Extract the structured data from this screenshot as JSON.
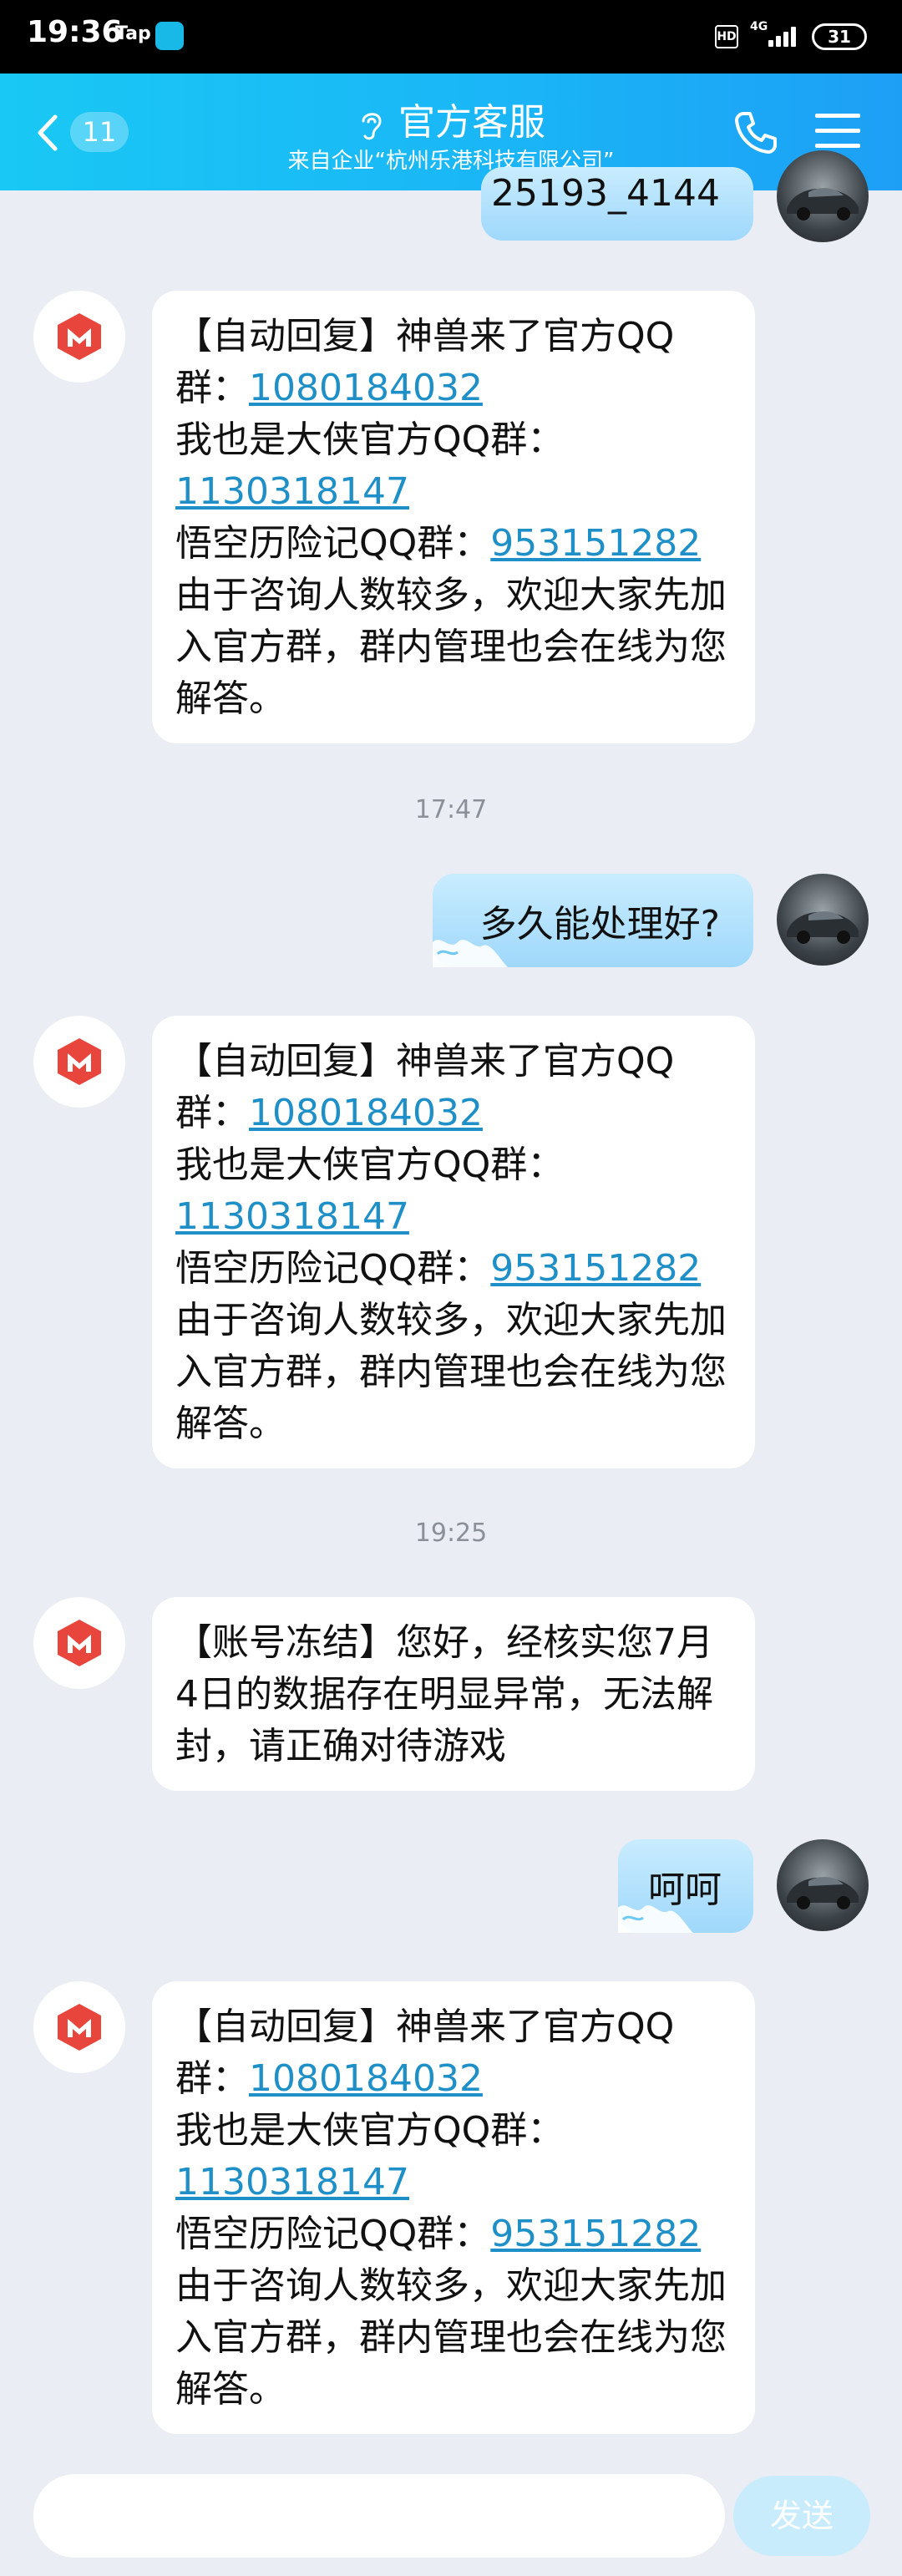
{
  "status_bar": {
    "time": "19:36",
    "tap_label": "Tap",
    "hd_label": "HD",
    "network_label": "4G",
    "battery_level": "31"
  },
  "header": {
    "back_count": "11",
    "title": "官方客服",
    "subtitle": "来自企业“杭州乐港科技有限公司”"
  },
  "messages": {
    "partial_user": "25193_4144",
    "auto_reply": {
      "p1": "【自动回复】神兽来了官方QQ群：",
      "g1": "1080184032",
      "p2": "我也是大侠官方QQ群：",
      "g2": "1130318147",
      "p3": "悟空历险记QQ群：",
      "g3": "953151282",
      "p4": "由于咨询人数较多，欢迎大家先加入官方群，群内管理也会在线为您解答。"
    },
    "time1": "17:47",
    "user_q": "多久能处理好?",
    "time2": "19:25",
    "freeze": "【账号冻结】您好，经核实您7月4日的数据存在明显异常，无法解封，请正确对待游戏",
    "user_laugh": "呵呵"
  },
  "input": {
    "send_label": "发送",
    "placeholder": ""
  },
  "colors": {
    "header_start": "#19c8f4",
    "header_end": "#1d9ff5",
    "link": "#1f8fc7",
    "background": "#eaedf4",
    "bot_logo": "#e8453c"
  }
}
